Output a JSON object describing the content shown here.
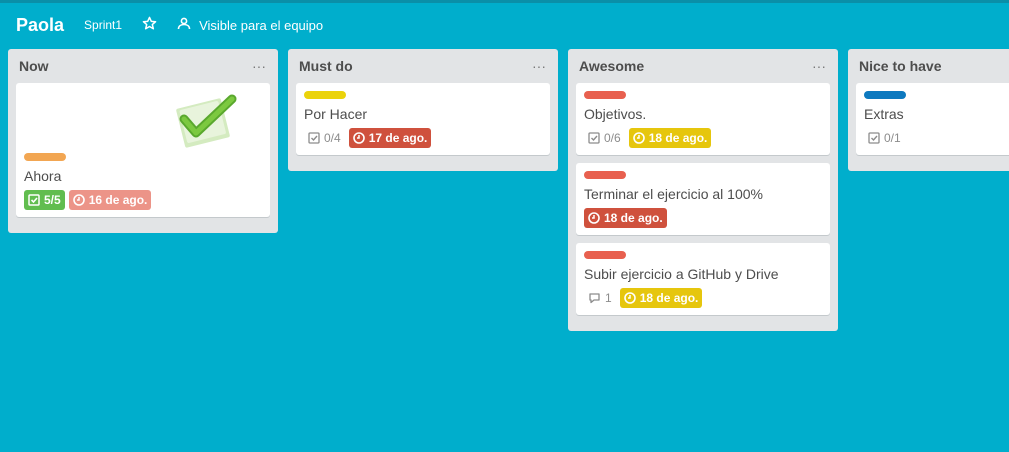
{
  "header": {
    "board_title": "Paola",
    "board_button": "Sprint1",
    "visibility": "Visible para el equipo"
  },
  "colors": {
    "background": "#00aecc",
    "label_orange": "#f2a652",
    "label_yellow": "#ebd30b",
    "label_red": "#e8604f",
    "label_blue": "#0d79bf",
    "due_green": "#61bd4f",
    "due_red": "#cf513d",
    "due_yellow": "#e6c60d",
    "due_faded_red": "#ec9488"
  },
  "lists": [
    {
      "title": "Now",
      "menu": "···",
      "cards": [
        {
          "cover": "green-checkmark-image",
          "label_color": "#f2a652",
          "title": "Ahora",
          "checklist": "5/5",
          "checklist_complete": true,
          "due": "16 de ago.",
          "due_color": "#ec9488"
        }
      ]
    },
    {
      "title": "Must do",
      "menu": "···",
      "cards": [
        {
          "label_color": "#ebd30b",
          "title": "Por Hacer",
          "checklist": "0/4",
          "due": "17 de ago.",
          "due_color": "#cf513d"
        }
      ]
    },
    {
      "title": "Awesome",
      "menu": "···",
      "cards": [
        {
          "label_color": "#e8604f",
          "title": "Objetivos.",
          "checklist": "0/6",
          "due": "18 de ago.",
          "due_color": "#e6c60d"
        },
        {
          "label_color": "#e8604f",
          "title": "Terminar el ejercicio al 100%",
          "due": "18 de ago.",
          "due_color": "#cf513d"
        },
        {
          "label_color": "#e8604f",
          "title": "Subir ejercicio a GitHub y Drive",
          "comments": "1",
          "due": "18 de ago.",
          "due_color": "#e6c60d"
        }
      ]
    },
    {
      "title": "Nice to have",
      "menu": "···",
      "cards": [
        {
          "label_color": "#0d79bf",
          "title": "Extras",
          "checklist": "0/1"
        }
      ]
    }
  ]
}
